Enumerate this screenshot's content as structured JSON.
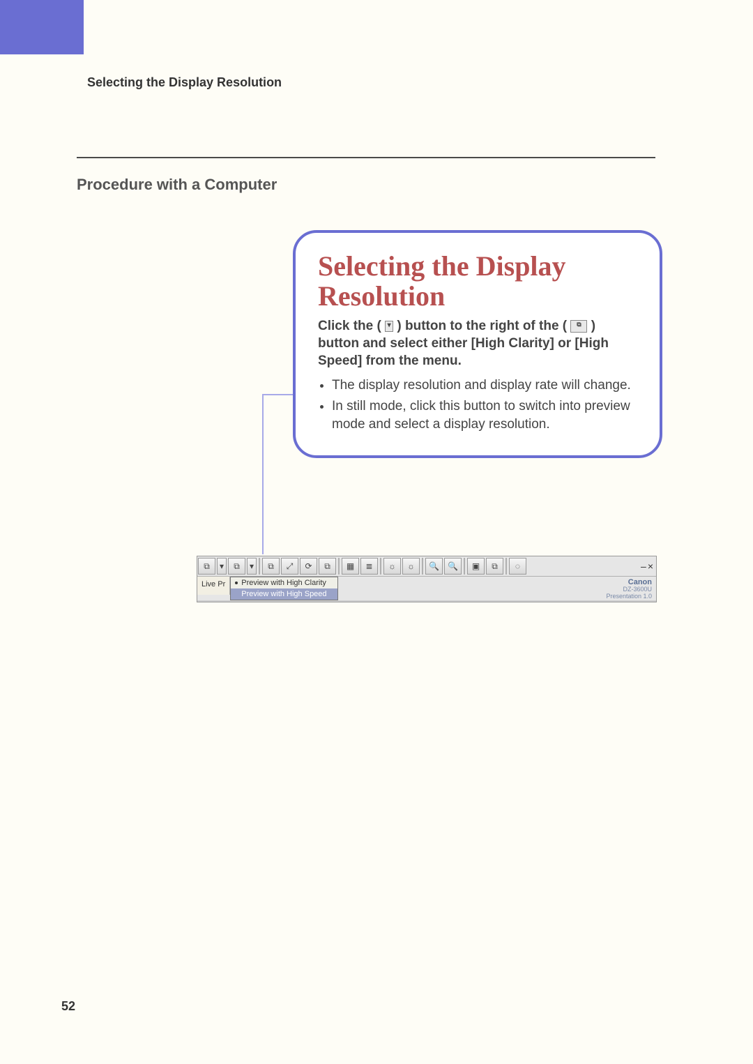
{
  "page": {
    "number": "52",
    "header": "Selecting the Display Resolution",
    "subhead": "Procedure with a Computer"
  },
  "callout": {
    "title": "Selecting the Display Resolution",
    "lead_part1": "Click the (",
    "lead_dropdown_icon": "▾",
    "lead_part2": ") button to the right of the (",
    "lead_camera_icon": "⧉",
    "lead_part3": ") button and select either [High Clarity] or [High Speed] from the menu.",
    "bullets": [
      "The display resolution and display rate will change.",
      "In still mode, click this button to switch into preview mode and select a display resolution."
    ]
  },
  "toolbar": {
    "window_controls": {
      "minimize": "–",
      "close": "×"
    },
    "buttons_row": [
      "⧉",
      "▾",
      "⧉",
      "▾",
      "⧉",
      "⤢",
      "⟳",
      "⧉",
      "▦",
      "≣",
      "☼",
      "☼",
      "🔍",
      "🔍",
      "▣",
      "⧉",
      "◌"
    ],
    "live_label": "Live Pr",
    "dropdown": {
      "items": [
        {
          "label": "Preview with High Clarity",
          "selected": true
        },
        {
          "label": "Preview with High Speed",
          "selected": false
        }
      ]
    },
    "brand": {
      "name": "Canon",
      "model": "DZ-3600U",
      "product": "Presentation 1.0"
    }
  }
}
